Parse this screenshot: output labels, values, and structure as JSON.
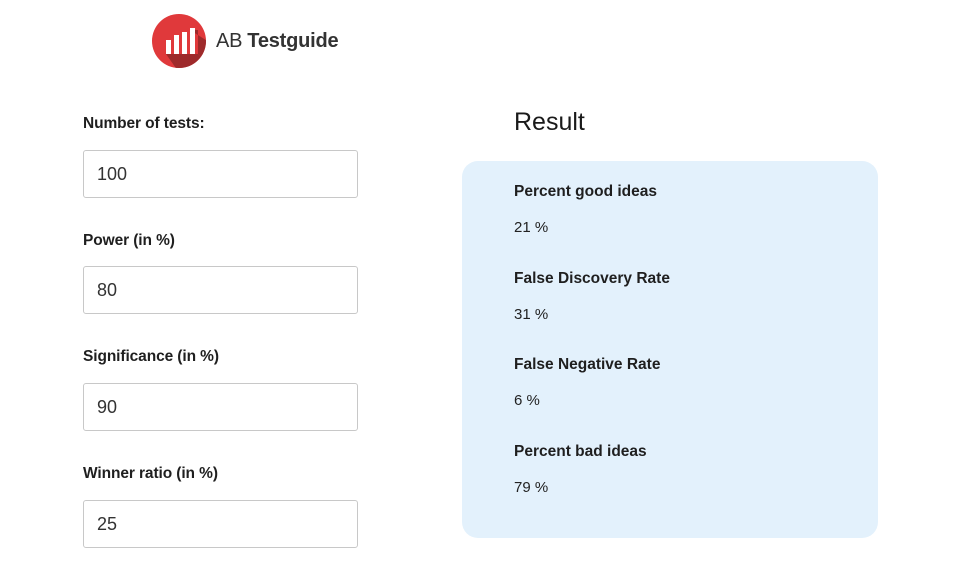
{
  "brand": {
    "name_prefix": "AB",
    "name_main": "Testguide",
    "logo_icon": "bar-chart-circle-icon",
    "colors": {
      "logo_red": "#e0393b",
      "logo_red_dark": "#9e2a2b",
      "panel_bg": "#e3f1fc"
    }
  },
  "form": {
    "number_of_tests": {
      "label": "Number of tests:",
      "value": "100"
    },
    "power": {
      "label": "Power (in %)",
      "value": "80"
    },
    "significance": {
      "label": "Significance (in %)",
      "value": "90"
    },
    "winner_ratio": {
      "label": "Winner ratio (in %)",
      "value": "25"
    }
  },
  "result": {
    "title": "Result",
    "items": [
      {
        "label": "Percent good ideas",
        "value": "21 %"
      },
      {
        "label": "False Discovery Rate",
        "value": "31 %"
      },
      {
        "label": "False Negative Rate",
        "value": "6 %"
      },
      {
        "label": "Percent bad ideas",
        "value": "79 %"
      }
    ]
  }
}
